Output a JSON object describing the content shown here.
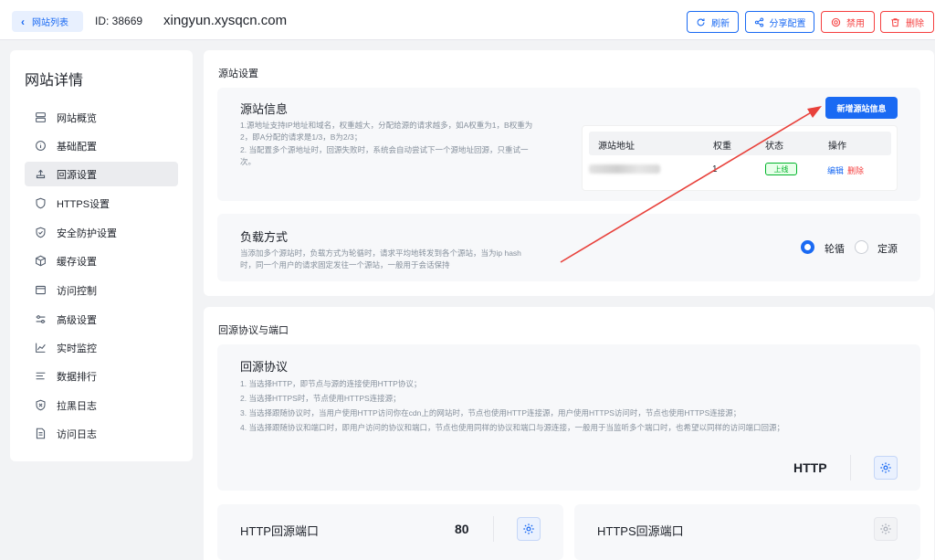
{
  "header": {
    "back_label": "网站列表",
    "site_id": "ID: 38669",
    "domain": "xingyun.xysqcn.com",
    "refresh_label": "刷新",
    "share_label": "分享配置",
    "disable_label": "禁用",
    "delete_label": "删除"
  },
  "sidebar": {
    "title": "网站详情",
    "items": [
      {
        "label": "网站概览",
        "icon": "overview-icon"
      },
      {
        "label": "基础配置",
        "icon": "info-icon"
      },
      {
        "label": "回源设置",
        "icon": "origin-icon",
        "active": true
      },
      {
        "label": "HTTPS设置",
        "icon": "shield-icon"
      },
      {
        "label": "安全防护设置",
        "icon": "shield-check-icon"
      },
      {
        "label": "缓存设置",
        "icon": "cube-icon"
      },
      {
        "label": "访问控制",
        "icon": "window-icon"
      },
      {
        "label": "高级设置",
        "icon": "sliders-icon"
      },
      {
        "label": "实时监控",
        "icon": "chart-icon"
      },
      {
        "label": "数据排行",
        "icon": "list-icon"
      },
      {
        "label": "拉黑日志",
        "icon": "block-shield-icon"
      },
      {
        "label": "访问日志",
        "icon": "document-icon"
      }
    ]
  },
  "origin_settings": {
    "section_title": "源站设置",
    "origin_info": {
      "title": "源站信息",
      "desc1": "1.源地址支持IP地址和域名，权重越大，分配给源的请求越多，如A权重为1，B权重为",
      "desc2": "2，即A分配的请求是1/3，B为2/3；",
      "desc3": "2. 当配置多个源地址时，回源失败时，系统会自动尝试下一个源地址回源，只重试一",
      "desc4": "次。",
      "add_button": "新增源站信息",
      "table": {
        "headers": [
          "源站地址",
          "权重",
          "状态",
          "操作"
        ],
        "rows": [
          {
            "address": "",
            "weight": "1",
            "status": "上线",
            "edit": "编辑",
            "delete": "删除"
          }
        ]
      }
    },
    "load_balance": {
      "title": "负载方式",
      "desc1": "当添加多个源站时，负载方式为轮循时，请求平均地转发到各个源站，当为ip hash",
      "desc2": "时，同一个用户的请求固定发往一个源站，一般用于会话保持",
      "options": [
        "轮循",
        "定源"
      ],
      "selected": "轮循"
    }
  },
  "protocol_settings": {
    "section_title": "回源协议与端口",
    "protocol": {
      "title": "回源协议",
      "notes": [
        "1. 当选择HTTP，即节点与源的连接使用HTTP协议；",
        "2. 当选择HTTPS时，节点使用HTTPS连接源；",
        "3. 当选择跟随协议时，当用户使用HTTP访问你在cdn上的网站时，节点也使用HTTP连接源，用户使用HTTPS访问时，节点也使用HTTPS连接源；",
        "4. 当选择跟随协议和端口时，即用户访问的协议和端口，节点也使用同样的协议和端口与源连接，一般用于当监听多个端口时，也希望以同样的访问端口回源；"
      ],
      "value": "HTTP"
    },
    "http_port": {
      "label": "HTTP回源端口",
      "value": "80"
    },
    "https_port": {
      "label": "HTTPS回源端口"
    }
  },
  "colors": {
    "primary": "#1a6af3",
    "danger": "#f53f3f",
    "success": "#00b42a",
    "annotation_arrow": "#e8413b"
  }
}
